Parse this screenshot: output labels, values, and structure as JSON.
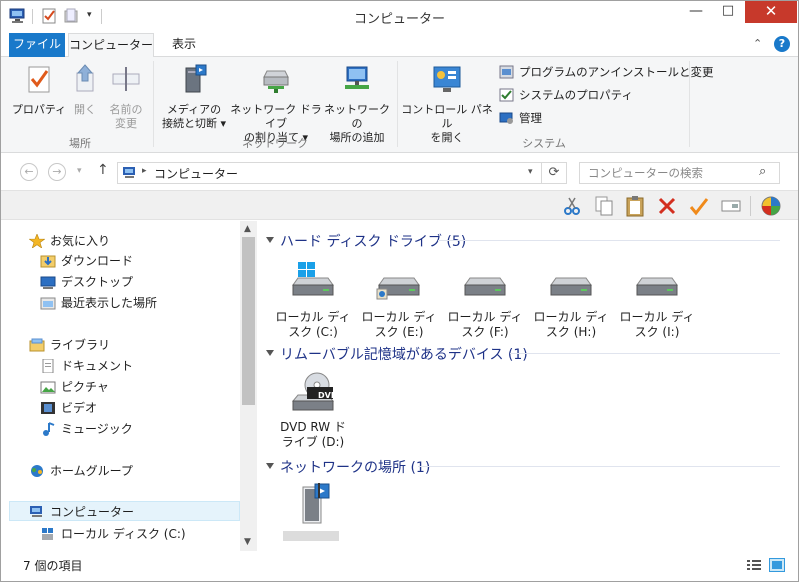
{
  "window": {
    "title": "コンピューター",
    "controls": {
      "minimize": "—",
      "maximize": "□",
      "close": "✕"
    }
  },
  "ribbon": {
    "tabs": {
      "file": "ファイル",
      "computer": "コンピューター",
      "view": "表示"
    },
    "groups": {
      "location": {
        "label": "場所",
        "buttons": {
          "properties": "プロパティ",
          "open": "開く",
          "rename_line1": "名前の",
          "rename_line2": "変更"
        }
      },
      "network": {
        "label": "ネットワーク",
        "buttons": {
          "media_line1": "メディアの",
          "media_line2": "接続と切断 ▾",
          "map_drive_line1": "ネットワーク ドライブ",
          "map_drive_line2": "の割り当て ▾",
          "add_location_line1": "ネットワークの",
          "add_location_line2": "場所の追加"
        }
      },
      "system": {
        "label": "システム",
        "buttons": {
          "control_panel_line1": "コントロール パネル",
          "control_panel_line2": "を開く",
          "uninstall": "プログラムのアンインストールと変更",
          "sys_props": "システムのプロパティ",
          "manage": "管理"
        }
      }
    }
  },
  "address": {
    "path": "コンピューター",
    "search_placeholder": "コンピューターの検索"
  },
  "nav_pane": {
    "favorites": "お気に入り",
    "downloads": "ダウンロード",
    "desktop": "デスクトップ",
    "recent": "最近表示した場所",
    "libraries": "ライブラリ",
    "documents": "ドキュメント",
    "pictures": "ピクチャ",
    "videos": "ビデオ",
    "music": "ミュージック",
    "homegroup": "ホームグループ",
    "computer": "コンピューター",
    "local_c": "ローカル ディスク (C:)"
  },
  "groups": {
    "hdd": "ハード ディスク ドライブ (5)",
    "removable": "リムーバブル記憶域があるデバイス (1)",
    "network": "ネットワークの場所 (1)"
  },
  "drives": [
    {
      "line1": "ローカル ディ",
      "line2": "スク (C:)"
    },
    {
      "line1": "ローカル ディ",
      "line2": "スク (E:)"
    },
    {
      "line1": "ローカル ディ",
      "line2": "スク (F:)"
    },
    {
      "line1": "ローカル ディ",
      "line2": "スク (H:)"
    },
    {
      "line1": "ローカル ディ",
      "line2": "スク (I:)"
    }
  ],
  "dvd": {
    "line1": "DVD RW ド",
    "line2": "ライブ (D:)",
    "badge": "DVD"
  },
  "status": {
    "count": "7 個の項目"
  }
}
